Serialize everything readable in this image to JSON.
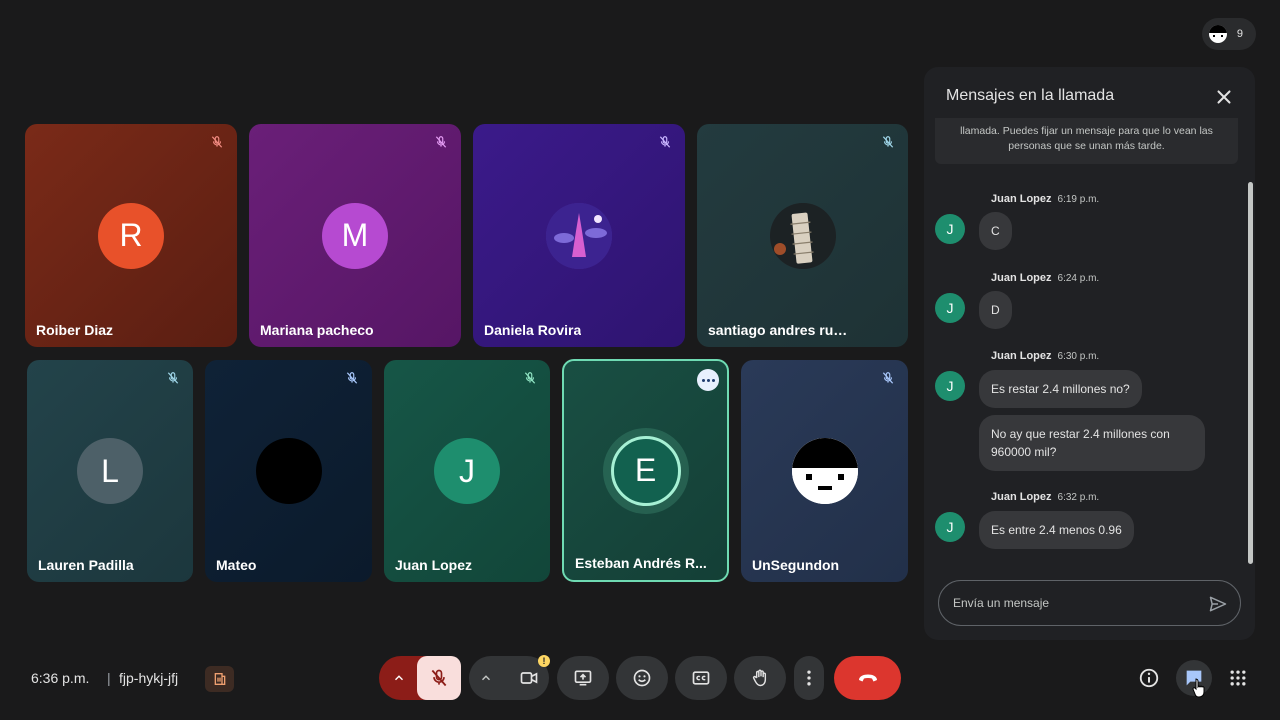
{
  "participants_count": "9",
  "tiles": [
    {
      "name": "Roiber Diaz",
      "initial": "R",
      "bg": "#7a2a18",
      "avatar_bg": "#e8512a"
    },
    {
      "name": "Mariana pacheco",
      "initial": "M",
      "bg": "#6a1f78",
      "avatar_bg": "#b64ad1"
    },
    {
      "name": "Daniela Rovira",
      "initial": "",
      "bg": "#3b1a8a",
      "avatar_bg": "#4b2a9e"
    },
    {
      "name": "santiago andres rueda",
      "initial": "",
      "bg": "#233b3f",
      "avatar_bg": "#2b3133"
    },
    {
      "name": "Lauren Padilla",
      "initial": "L",
      "bg": "#23434a",
      "avatar_bg": "#4d6068"
    },
    {
      "name": "Mateo",
      "initial": "",
      "bg": "#0f2237",
      "avatar_bg": "#000000"
    },
    {
      "name": "Juan Lopez",
      "initial": "J",
      "bg": "#165647",
      "avatar_bg": "#1e8e6e"
    },
    {
      "name": "Esteban Andrés R...",
      "initial": "E",
      "bg": "#194f43",
      "avatar_bg": "#12614f"
    },
    {
      "name": "UnSegundon",
      "initial": "",
      "bg": "#2a3a58",
      "avatar_bg": "#ffffff"
    }
  ],
  "chat": {
    "title": "Mensajes en la llamada",
    "info": "llamada. Puedes fijar un mensaje para que lo vean las personas que se unan más tarde.",
    "groups": [
      {
        "sender": "Juan Lopez",
        "time": "6:19 p.m.",
        "avatar": "J",
        "messages": [
          "C"
        ]
      },
      {
        "sender": "Juan Lopez",
        "time": "6:24 p.m.",
        "avatar": "J",
        "messages": [
          "D"
        ]
      },
      {
        "sender": "Juan Lopez",
        "time": "6:30 p.m.",
        "avatar": "J",
        "messages": [
          "Es restar 2.4 millones no?",
          "No ay que restar 2.4 millones con 960000 mil?"
        ]
      },
      {
        "sender": "Juan Lopez",
        "time": "6:32 p.m.",
        "avatar": "J",
        "messages": [
          "Es entre 2.4 menos 0.96"
        ]
      }
    ],
    "input_placeholder": "Envía un mensaje"
  },
  "footer": {
    "time": "6:36 p.m.",
    "separator": "|",
    "meeting_code": "fjp-hykj-jfj"
  },
  "colors": {
    "end_call": "#dc362e",
    "mic_off_bg": "#f9dedc",
    "accent_green": "#6fdbb3",
    "warning": "#fdd663"
  },
  "icons": [
    "close-icon",
    "send-icon",
    "mic-off-icon",
    "chevron-up-icon",
    "camera-icon",
    "present-icon",
    "emoji-icon",
    "captions-icon",
    "hand-icon",
    "more-vert-icon",
    "phone-end-icon",
    "info-icon",
    "chat-icon",
    "apps-grid-icon",
    "host-controls-icon"
  ]
}
